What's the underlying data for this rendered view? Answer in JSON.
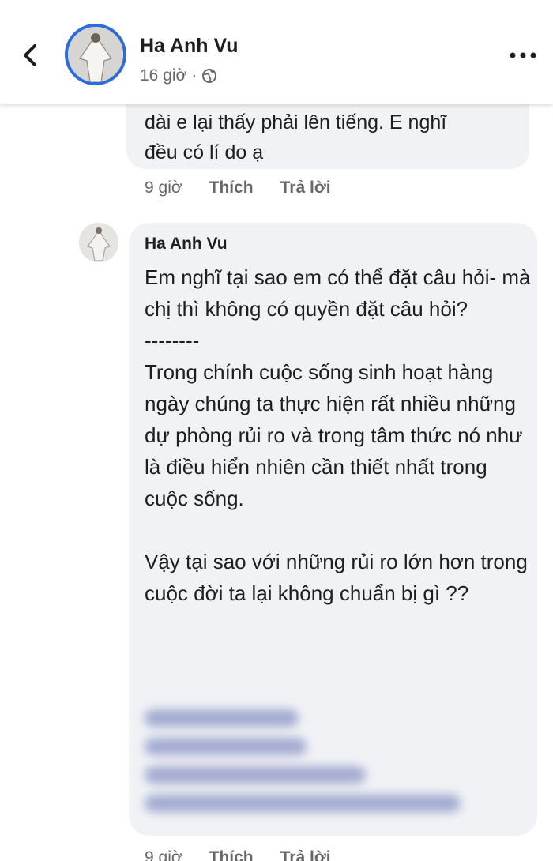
{
  "header": {
    "back_icon": "chevron-left-icon",
    "author_name": "Ha Anh Vu",
    "post_time": "16 giờ",
    "separator": "·",
    "privacy_icon": "globe-icon",
    "more_icon": "more-horizontal-icon"
  },
  "comment_top": {
    "lines": [
      "dài e lại thấy phải lên tiếng. E nghĩ",
      "đều có lí do ạ"
    ],
    "time": "9 giờ",
    "like_label": "Thích",
    "reply_label": "Trả lời"
  },
  "reply": {
    "author_name": "Ha Anh Vu",
    "paragraph_1": "Em nghĩ tại sao em có thể đặt câu hỏi- mà chị thì không có quyền đặt câu hỏi?",
    "divider": "--------",
    "paragraph_2": "Trong chính cuộc sống sinh hoạt hàng ngày chúng ta thực hiện rất nhiều những dự phòng rủi ro và trong tâm thức nó như là điều hiển nhiên cần thiết nhất trong cuộc sống.",
    "paragraph_3": "Vậy tại sao với những rủi ro lớn hơn trong cuộc đời ta lại không chuẩn bị gì ??",
    "time": "9 giờ",
    "like_label": "Thích",
    "reply_label": "Trả lời"
  },
  "colors": {
    "accent_ring": "#2d6cdf",
    "bubble_bg": "#f0f2f5",
    "secondary_text": "#65676b",
    "blur_text": "#8a93c4"
  }
}
